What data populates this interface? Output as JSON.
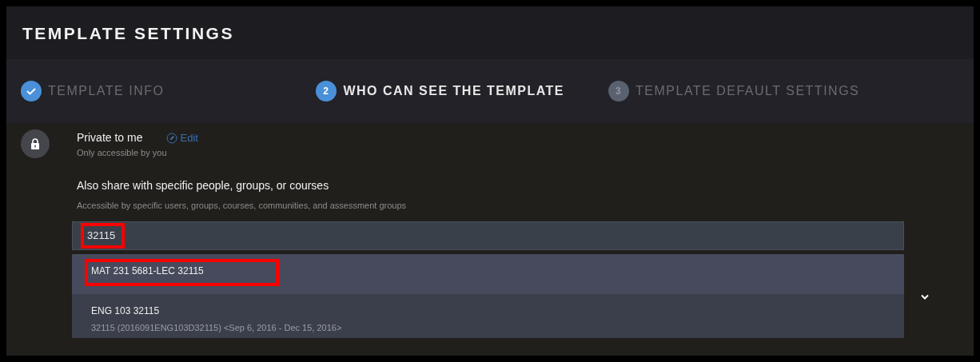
{
  "title": "TEMPLATE SETTINGS",
  "steps": [
    {
      "label": "TEMPLATE INFO",
      "completed": true,
      "selected": false
    },
    {
      "number": "2",
      "label": "WHO CAN SEE THE TEMPLATE",
      "completed": false,
      "selected": true
    },
    {
      "number": "3",
      "label": "TEMPLATE DEFAULT SETTINGS",
      "completed": false,
      "selected": false
    }
  ],
  "privacy": {
    "label": "Private to me",
    "edit_link": "Edit",
    "description": "Only accessible by you"
  },
  "share": {
    "label": "Also share with specific people, groups, or courses",
    "description": "Accessible by specific users, groups, courses, communities, and assessment groups"
  },
  "search": {
    "value": "32115",
    "highlighted": true
  },
  "results": [
    {
      "title": "MAT 231 5681-LEC 32115",
      "selected": true,
      "highlighted": true
    },
    {
      "title": "ENG 103 32115",
      "detail": "32115 (2016091ENG103D32115) <Sep 6, 2016 - Dec 15, 2016>",
      "selected": false,
      "highlighted": false
    }
  ]
}
